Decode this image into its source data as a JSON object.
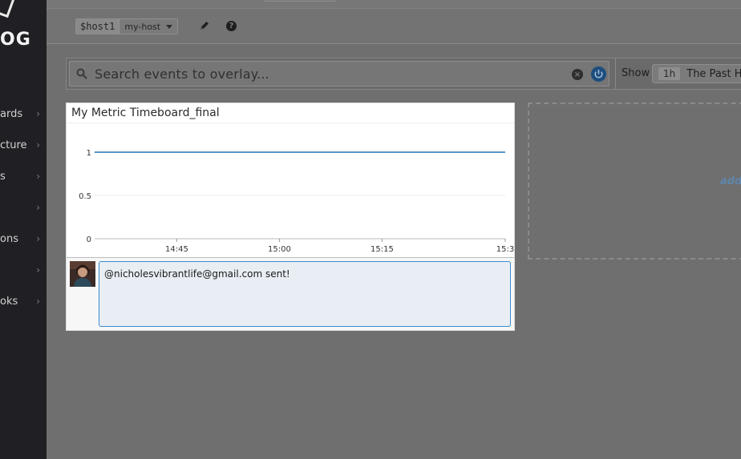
{
  "brand": {
    "logo_text": "OG"
  },
  "sidebar": {
    "items": [
      {
        "label": "ards",
        "chevron": "›"
      },
      {
        "label": "cture",
        "chevron": "›"
      },
      {
        "label": "s",
        "chevron": "›"
      },
      {
        "label": "",
        "chevron": "›"
      },
      {
        "label": "ons",
        "chevron": "›"
      },
      {
        "label": "",
        "chevron": "›"
      },
      {
        "label": "oks",
        "chevron": "›"
      }
    ]
  },
  "template_variables": {
    "name": "$host1",
    "value": "my-host"
  },
  "search": {
    "placeholder": "Search events to overlay..."
  },
  "timeframe": {
    "show_label": "Show",
    "badge": "1h",
    "text": "The Past Hour"
  },
  "widget": {
    "title": "My Metric Timeboard_final",
    "comment": "@nicholesvibrantlife@gmail.com sent!"
  },
  "placeholder": {
    "add_text": "add"
  },
  "chart_data": {
    "type": "line",
    "title": "My Metric Timeboard_final",
    "x_ticks": [
      "14:45",
      "15:00",
      "15:15",
      "15:3"
    ],
    "y_ticks": [
      "0",
      "0.5",
      "1"
    ],
    "ylim": [
      0,
      1
    ],
    "series": [
      {
        "values": [
          1,
          1,
          1,
          1,
          1,
          1
        ]
      }
    ],
    "x": [
      "14:33",
      "14:45",
      "15:00",
      "15:15",
      "15:25",
      "15:33"
    ],
    "grid": true,
    "line_color": "#1f77b4"
  }
}
